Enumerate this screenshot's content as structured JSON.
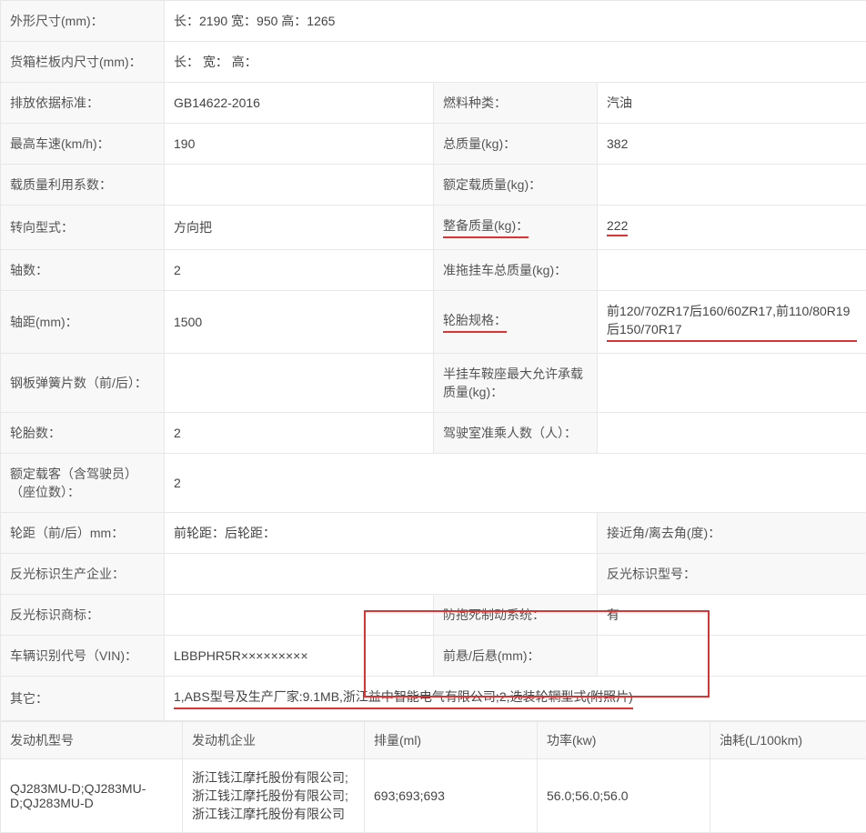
{
  "rows": {
    "dim_label": "外形尺寸(mm)：",
    "dim_value": "长：2190 宽：950 高：1265",
    "cargo_label": "货箱栏板内尺寸(mm)：",
    "cargo_value": "长： 宽： 高：",
    "emission_label": "排放依据标准：",
    "emission_value": "GB14622-2016",
    "fuel_label": "燃料种类：",
    "fuel_value": "汽油",
    "maxspeed_label": "最高车速(km/h)：",
    "maxspeed_value": "190",
    "gross_label": "总质量(kg)：",
    "gross_value": "382",
    "loadcoef_label": "载质量利用系数：",
    "loadcoef_value": "",
    "rated_label": "额定载质量(kg)：",
    "rated_value": "",
    "steer_label": "转向型式：",
    "steer_value": "方向把",
    "curb_label": "整备质量(kg)：",
    "curb_value": "222",
    "axles_label": "轴数：",
    "axles_value": "2",
    "trailer_label": "准拖挂车总质量(kg)：",
    "trailer_value": "",
    "wheelbase_label": "轴距(mm)：",
    "wheelbase_value": "1500",
    "tire_label": "轮胎规格：",
    "tire_value": "前120/70ZR17后160/60ZR17,前110/80R19后150/70R17",
    "leaf_label": "钢板弹簧片数（前/后）：",
    "leaf_value": "",
    "saddle_label": "半挂车鞍座最大允许承载质量(kg)：",
    "saddle_value": "",
    "tirecount_label": "轮胎数：",
    "tirecount_value": "2",
    "cab_label": "驾驶室准乘人数（人）：",
    "cab_value": "",
    "passenger_label": "额定载客（含驾驶员）（座位数）：",
    "passenger_value": "2",
    "track_label": "轮距（前/后）mm：",
    "track_value": "前轮距：后轮距：",
    "angle_label": "接近角/离去角(度)：",
    "angle_value": "",
    "refl_mfr_label": "反光标识生产企业：",
    "refl_mfr_value": "",
    "refl_model_label": "反光标识型号：",
    "refl_model_value": "",
    "refl_brand_label": "反光标识商标：",
    "refl_brand_value": "",
    "abs_label": "防抱死制动系统：",
    "abs_value": "有",
    "vin_label": "车辆识别代号（VIN)：",
    "vin_value": "LBBPHR5R×××××××××",
    "overhang_label": "前悬/后悬(mm)：",
    "overhang_value": "",
    "other_label": "其它：",
    "other_value": "1,ABS型号及生产厂家:9.1MB,浙江益中智能电气有限公司;2,选装轮辋型式(附照片)"
  },
  "engine": {
    "headers": {
      "model": "发动机型号",
      "mfr": "发动机企业",
      "disp": "排量(ml)",
      "power": "功率(kw)",
      "fuel": "油耗(L/100km)"
    },
    "row": {
      "model": "QJ283MU-D;QJ283MU-D;QJ283MU-D",
      "mfr": "浙江钱江摩托股份有限公司;浙江钱江摩托股份有限公司;浙江钱江摩托股份有限公司",
      "disp": "693;693;693",
      "power": "56.0;56.0;56.0",
      "fuel": ""
    }
  }
}
